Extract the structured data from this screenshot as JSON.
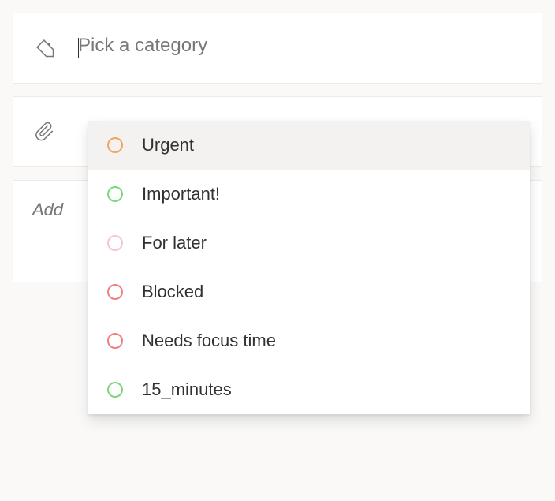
{
  "category_field": {
    "placeholder": "Pick a category",
    "value": ""
  },
  "attachment_field": {
    "placeholder": "",
    "value": ""
  },
  "notes_field": {
    "label_partial": "Add"
  },
  "categories": [
    {
      "label": "Urgent",
      "color": "#f0a55e",
      "hover": true
    },
    {
      "label": "Important!",
      "color": "#7bd87b",
      "hover": false
    },
    {
      "label": "For later",
      "color": "#f5c5d3",
      "hover": false
    },
    {
      "label": "Blocked",
      "color": "#f08080",
      "hover": false
    },
    {
      "label": "Needs focus time",
      "color": "#f08080",
      "hover": false
    },
    {
      "label": "15_minutes",
      "color": "#7bd87b",
      "hover": false
    }
  ]
}
